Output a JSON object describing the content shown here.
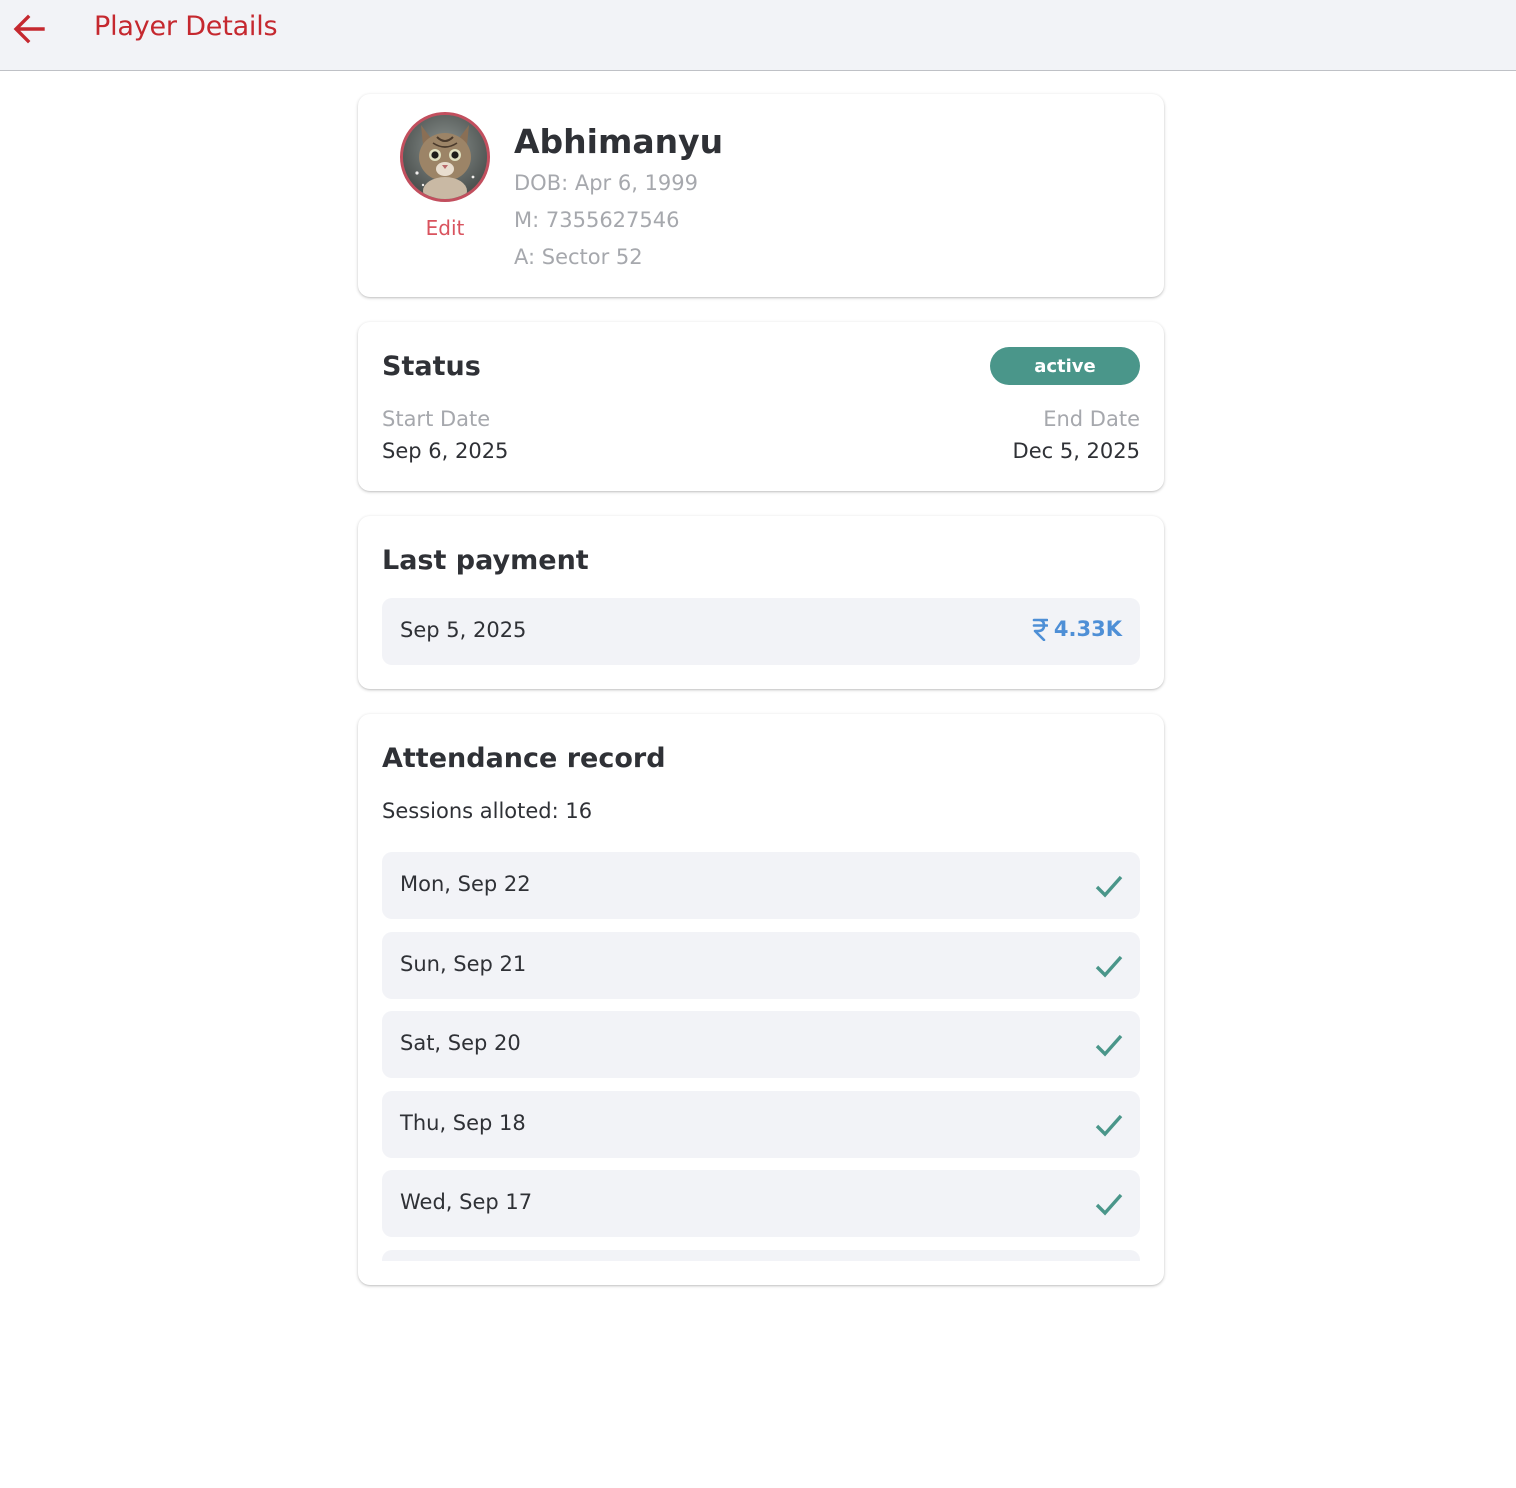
{
  "appbar": {
    "title": "Player Details",
    "back_icon": "arrow-left-icon",
    "accent_color": "#c5282f"
  },
  "profile": {
    "name": "Abhimanyu",
    "dob": "DOB: Apr 6, 1999",
    "mobile": "M: 7355627546",
    "address": "A: Sector 52",
    "edit_label": "Edit",
    "avatar_icon": "cat-avatar-photo"
  },
  "status": {
    "heading": "Status",
    "badge": "active",
    "badge_color": "#4a968a",
    "start_label": "Start Date",
    "start_value": "Sep 6, 2025",
    "end_label": "End Date",
    "end_value": "Dec 5, 2025"
  },
  "payment": {
    "heading": "Last payment",
    "date": "Sep 5, 2025",
    "amount": "4.33K",
    "currency_icon": "rupee-icon",
    "amount_color": "#4e8fd6"
  },
  "attendance": {
    "heading": "Attendance record",
    "sessions": "Sessions alloted: 16",
    "check_icon": "check-icon",
    "check_color": "#4a968a",
    "records": [
      {
        "date": "Mon, Sep 22"
      },
      {
        "date": "Sun, Sep 21"
      },
      {
        "date": "Sat, Sep 20"
      },
      {
        "date": "Thu, Sep 18"
      },
      {
        "date": "Wed, Sep 17"
      }
    ]
  }
}
